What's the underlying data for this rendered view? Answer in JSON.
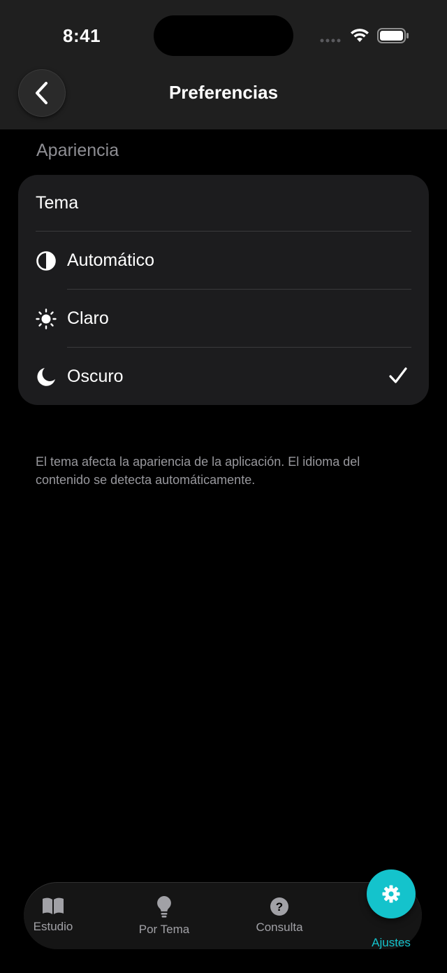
{
  "status_bar": {
    "time": "8:41"
  },
  "nav": {
    "title": "Preferencias"
  },
  "appearance": {
    "section_header": "Apariencia",
    "theme_label": "Tema",
    "options": [
      {
        "label": "Automático",
        "icon": "half-circle-icon",
        "selected": false
      },
      {
        "label": "Claro",
        "icon": "sun-icon",
        "selected": false
      },
      {
        "label": "Oscuro",
        "icon": "moon-icon",
        "selected": true
      }
    ],
    "footnote": "El tema afecta la apariencia de la aplicación. El idioma del contenido se detecta automáticamente."
  },
  "tab_bar": {
    "tabs": [
      {
        "label": "Estudio",
        "icon": "book-icon"
      },
      {
        "label": "Por Tema",
        "icon": "lightbulb-icon"
      },
      {
        "label": "Consulta",
        "icon": "question-icon"
      },
      {
        "label": "Ajustes",
        "icon": "gear-icon",
        "active": true
      }
    ]
  },
  "colors": {
    "background": "#000000",
    "card": "#1c1c1e",
    "accent": "#14c3cc",
    "secondary_text": "#8e8e93"
  }
}
